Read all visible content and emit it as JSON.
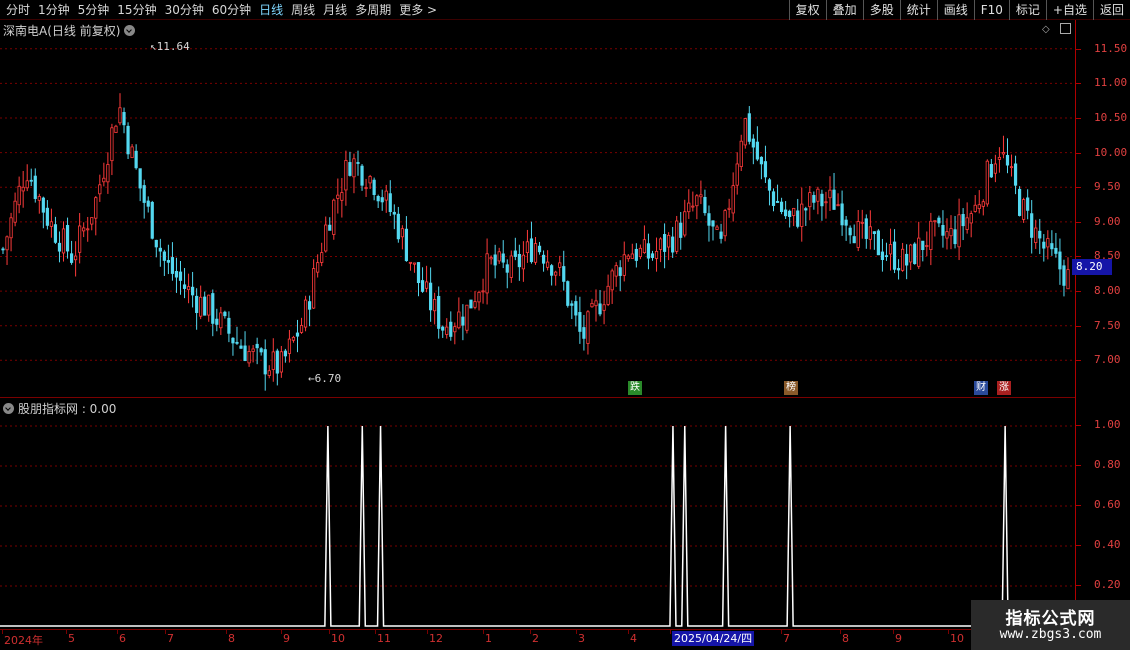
{
  "toolbar": {
    "periods": [
      "分时",
      "1分钟",
      "5分钟",
      "15分钟",
      "30分钟",
      "60分钟",
      "日线",
      "周线",
      "月线",
      "多周期",
      "更多 >"
    ],
    "active_period": "日线",
    "buttons": [
      "复权",
      "叠加",
      "多股",
      "统计",
      "画线",
      "F10",
      "标记",
      "+自选",
      "返回"
    ]
  },
  "main_panel": {
    "title": "深南电A(日线 前复权)",
    "high_label": "11.64",
    "low_label": "6.70",
    "last_price": "8.20",
    "markers": [
      {
        "text": "跌",
        "color": "#2a8a2a"
      },
      {
        "text": "榜",
        "color": "#8a5a2a"
      },
      {
        "text": "财",
        "color": "#2a4a9a"
      },
      {
        "text": "涨",
        "color": "#aa2020"
      }
    ]
  },
  "indicator_panel": {
    "title": "股朋指标网 : 0.00"
  },
  "price_axis": [
    "11.50",
    "11.00",
    "10.50",
    "10.00",
    "9.50",
    "9.00",
    "8.50",
    "8.00",
    "7.50",
    "7.00"
  ],
  "indicator_axis": [
    "1.00",
    "0.80",
    "0.60",
    "0.40",
    "0.20"
  ],
  "date_axis": [
    "2024年",
    "5",
    "6",
    "7",
    "8",
    "9",
    "10",
    "11",
    "12",
    "1",
    "2",
    "3",
    "4",
    "2025/04/24/四",
    "7",
    "8",
    "9",
    "10"
  ],
  "watermark": {
    "title": "指标公式网",
    "url": "www.zbgs3.com"
  },
  "chart_data": [
    {
      "type": "candlestick",
      "title": "深南电A(日线 前复权)",
      "ylim": [
        6.6,
        11.8
      ],
      "grid": true,
      "annotations": [
        {
          "text": "11.64",
          "meaning": "period high"
        },
        {
          "text": "6.70",
          "meaning": "period low"
        }
      ],
      "x": [
        "2024年",
        "5",
        "6",
        "7",
        "8",
        "9",
        "10",
        "11",
        "12",
        "1",
        "2",
        "3",
        "4",
        "7",
        "8",
        "9",
        "10"
      ],
      "close_series": [
        8.6,
        9.8,
        9.0,
        8.5,
        9.3,
        10.7,
        9.4,
        8.4,
        8.0,
        7.7,
        7.3,
        7.0,
        6.9,
        7.6,
        9.0,
        9.9,
        9.6,
        9.0,
        8.1,
        7.5,
        7.7,
        8.4,
        8.3,
        8.7,
        8.3,
        7.3,
        8.0,
        8.6,
        8.5,
        8.8,
        9.3,
        8.6,
        10.5,
        9.5,
        9.0,
        9.3,
        9.3,
        8.8,
        8.6,
        8.4,
        8.8,
        8.8,
        9.2,
        10.1,
        9.2,
        8.6,
        8.2
      ]
    },
    {
      "type": "line",
      "name": "股朋指标网",
      "ylim": [
        0,
        1.05
      ],
      "signal_positions_fraction": [
        0.305,
        0.337,
        0.354,
        0.626,
        0.637,
        0.675,
        0.735,
        0.935
      ],
      "signal_value": 1.0,
      "baseline_value": 0.0
    }
  ]
}
